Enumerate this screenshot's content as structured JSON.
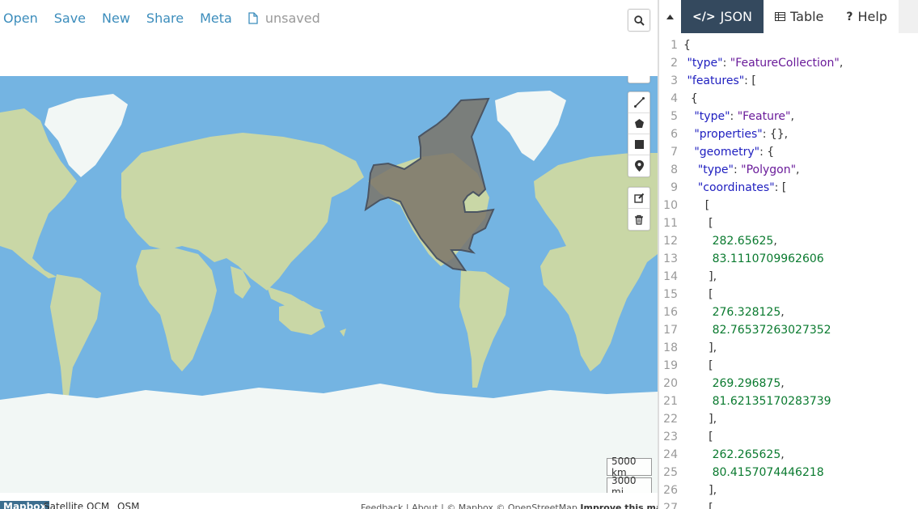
{
  "menu": {
    "open": "Open",
    "save": "Save",
    "new": "New",
    "share": "Share",
    "meta": "Meta",
    "status": "unsaved"
  },
  "map": {
    "scale_km": "5000 km",
    "scale_mi": "3000 mi",
    "layers": [
      "Mapbox",
      "Satellite",
      "OCM",
      "OSM"
    ],
    "attribution_text": "Feedback | About | © Mapbox © OpenStreetMap",
    "attribution_bold": "Improve this map"
  },
  "tabs": {
    "json": "JSON",
    "table": "Table",
    "help": "Help"
  },
  "code": [
    {
      "n": "1",
      "parts": [
        [
          "p",
          "{"
        ]
      ]
    },
    {
      "n": "2",
      "parts": [
        [
          "p",
          " "
        ],
        [
          "k",
          "\"type\""
        ],
        [
          "p",
          ": "
        ],
        [
          "s",
          "\"FeatureCollection\""
        ],
        [
          "p",
          ","
        ]
      ]
    },
    {
      "n": "3",
      "parts": [
        [
          "p",
          " "
        ],
        [
          "k",
          "\"features\""
        ],
        [
          "p",
          ": ["
        ]
      ]
    },
    {
      "n": "4",
      "parts": [
        [
          "p",
          "  {"
        ]
      ]
    },
    {
      "n": "5",
      "parts": [
        [
          "p",
          "   "
        ],
        [
          "k",
          "\"type\""
        ],
        [
          "p",
          ": "
        ],
        [
          "s",
          "\"Feature\""
        ],
        [
          "p",
          ","
        ]
      ]
    },
    {
      "n": "6",
      "parts": [
        [
          "p",
          "   "
        ],
        [
          "k",
          "\"properties\""
        ],
        [
          "p",
          ": {},"
        ]
      ]
    },
    {
      "n": "7",
      "parts": [
        [
          "p",
          "   "
        ],
        [
          "k",
          "\"geometry\""
        ],
        [
          "p",
          ": {"
        ]
      ]
    },
    {
      "n": "8",
      "parts": [
        [
          "p",
          "    "
        ],
        [
          "k",
          "\"type\""
        ],
        [
          "p",
          ": "
        ],
        [
          "s",
          "\"Polygon\""
        ],
        [
          "p",
          ","
        ]
      ]
    },
    {
      "n": "9",
      "parts": [
        [
          "p",
          "    "
        ],
        [
          "k",
          "\"coordinates\""
        ],
        [
          "p",
          ": ["
        ]
      ]
    },
    {
      "n": "10",
      "parts": [
        [
          "p",
          "      ["
        ]
      ]
    },
    {
      "n": "11",
      "parts": [
        [
          "p",
          "       ["
        ]
      ]
    },
    {
      "n": "12",
      "parts": [
        [
          "p",
          "        "
        ],
        [
          "n",
          "282.65625"
        ],
        [
          "p",
          ","
        ]
      ]
    },
    {
      "n": "13",
      "parts": [
        [
          "p",
          "        "
        ],
        [
          "n",
          "83.1110709962606"
        ]
      ]
    },
    {
      "n": "14",
      "parts": [
        [
          "p",
          "       ],"
        ]
      ]
    },
    {
      "n": "15",
      "parts": [
        [
          "p",
          "       ["
        ]
      ]
    },
    {
      "n": "16",
      "parts": [
        [
          "p",
          "        "
        ],
        [
          "n",
          "276.328125"
        ],
        [
          "p",
          ","
        ]
      ]
    },
    {
      "n": "17",
      "parts": [
        [
          "p",
          "        "
        ],
        [
          "n",
          "82.76537263027352"
        ]
      ]
    },
    {
      "n": "18",
      "parts": [
        [
          "p",
          "       ],"
        ]
      ]
    },
    {
      "n": "19",
      "parts": [
        [
          "p",
          "       ["
        ]
      ]
    },
    {
      "n": "20",
      "parts": [
        [
          "p",
          "        "
        ],
        [
          "n",
          "269.296875"
        ],
        [
          "p",
          ","
        ]
      ]
    },
    {
      "n": "21",
      "parts": [
        [
          "p",
          "        "
        ],
        [
          "n",
          "81.62135170283739"
        ]
      ]
    },
    {
      "n": "22",
      "parts": [
        [
          "p",
          "       ],"
        ]
      ]
    },
    {
      "n": "23",
      "parts": [
        [
          "p",
          "       ["
        ]
      ]
    },
    {
      "n": "24",
      "parts": [
        [
          "p",
          "        "
        ],
        [
          "n",
          "262.265625"
        ],
        [
          "p",
          ","
        ]
      ]
    },
    {
      "n": "25",
      "parts": [
        [
          "p",
          "        "
        ],
        [
          "n",
          "80.4157074446218"
        ]
      ]
    },
    {
      "n": "26",
      "parts": [
        [
          "p",
          "       ],"
        ]
      ]
    },
    {
      "n": "27",
      "parts": [
        [
          "p",
          "       ["
        ]
      ]
    }
  ],
  "colors": {
    "ocean": "#74b4e2",
    "land": "#c9d7a6",
    "ice": "#f2f7f5",
    "polygon_fill": "#7b7468",
    "polygon_stroke": "#4b5563",
    "accent": "#3c8dbc",
    "tab_active": "#34495e"
  }
}
